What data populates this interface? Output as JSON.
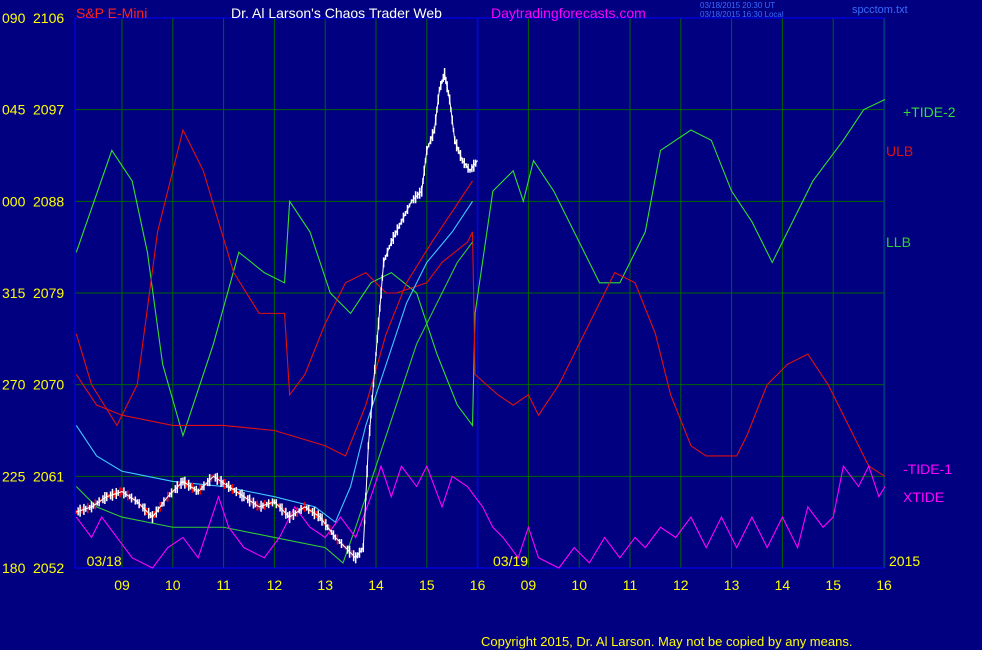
{
  "header": {
    "symbol": "S&P E-Mini",
    "title": "Dr. Al Larson's Chaos Trader Web",
    "site": "Daytradingforecasts.com",
    "stamp_line1": "03/18/2015 20:30 UT",
    "stamp_line2": "03/18/2015 16:30 Local",
    "file": "spcctom.txt"
  },
  "footer": {
    "copyright": "Copyright 2015, Dr. Al Larson. May not be copied by any means."
  },
  "colors": {
    "background": "#000080",
    "frame": "#0000ff",
    "grid": "#006400",
    "axis_text": "#ffff00",
    "header_red": "#ff2020",
    "header_white": "#ffffff",
    "header_magenta": "#ff00ff",
    "price": "#ffffff",
    "price_down": "#ff0000",
    "tide2": "#33dd33",
    "ulb": "#e01010",
    "llb": "#33cc33",
    "cyan": "#40c8ff",
    "tide1": "#e01010",
    "xtide": "#ff00ff"
  },
  "chart_data": {
    "type": "line",
    "ylim": [
      2052,
      2106
    ],
    "left_ticks": [
      {
        "label": "090",
        "price": "2106",
        "value": 2106
      },
      {
        "label": "045",
        "price": "2097",
        "value": 2097
      },
      {
        "label": "000",
        "price": "2088",
        "value": 2088
      },
      {
        "label": "315",
        "price": "2079",
        "value": 2079
      },
      {
        "label": "270",
        "price": "2070",
        "value": 2070
      },
      {
        "label": "225",
        "price": "2061",
        "value": 2061
      },
      {
        "label": "180",
        "price": "2052",
        "value": 2052
      }
    ],
    "hour_labels": [
      "09",
      "10",
      "11",
      "12",
      "13",
      "14",
      "15",
      "16",
      "09",
      "10",
      "11",
      "12",
      "13",
      "14",
      "15",
      "16"
    ],
    "hour_index": [
      0,
      1,
      2,
      3,
      4,
      5,
      6,
      7,
      8,
      9,
      10,
      11,
      12,
      13,
      14,
      15
    ],
    "x_start": -0.9,
    "x_end": 15.05,
    "date_labels": [
      {
        "text": "03/18",
        "at": -0.5
      },
      {
        "text": "03/19",
        "at": 7.5
      }
    ],
    "year_label": "2015",
    "divider_at": 7.0,
    "series": [
      {
        "name": "+TIDE-2",
        "color": "#33dd33",
        "points": [
          [
            -0.9,
            2083
          ],
          [
            -0.2,
            2093
          ],
          [
            0.2,
            2090
          ],
          [
            0.5,
            2083
          ],
          [
            0.8,
            2072
          ],
          [
            1.2,
            2065
          ],
          [
            1.8,
            2074
          ],
          [
            2.3,
            2083
          ],
          [
            2.8,
            2081
          ],
          [
            3.2,
            2080
          ],
          [
            3.3,
            2088
          ],
          [
            3.7,
            2085
          ],
          [
            4.1,
            2079
          ],
          [
            4.5,
            2077
          ],
          [
            4.9,
            2080
          ],
          [
            5.3,
            2081
          ],
          [
            5.8,
            2079
          ],
          [
            6.2,
            2073
          ],
          [
            6.6,
            2068
          ],
          [
            6.9,
            2066
          ],
          [
            6.95,
            2077
          ],
          [
            7.3,
            2089
          ],
          [
            7.7,
            2091
          ],
          [
            7.9,
            2088
          ],
          [
            8.1,
            2092
          ],
          [
            8.5,
            2089
          ],
          [
            8.9,
            2085
          ],
          [
            9.4,
            2080
          ],
          [
            9.8,
            2080
          ],
          [
            10.3,
            2085
          ],
          [
            10.6,
            2093
          ],
          [
            11.2,
            2095
          ],
          [
            11.6,
            2094
          ],
          [
            12.0,
            2089
          ],
          [
            12.4,
            2086
          ],
          [
            12.8,
            2082
          ],
          [
            13.2,
            2086
          ],
          [
            13.6,
            2090
          ],
          [
            14.2,
            2094
          ],
          [
            14.6,
            2097
          ],
          [
            15.05,
            2098
          ]
        ]
      },
      {
        "name": "ULB",
        "color": "#e01010",
        "points": [
          [
            -0.9,
            2075
          ],
          [
            -0.6,
            2070
          ],
          [
            -0.1,
            2066
          ],
          [
            0.3,
            2070
          ],
          [
            0.7,
            2085
          ],
          [
            1.2,
            2095
          ],
          [
            1.6,
            2091
          ],
          [
            2.2,
            2081
          ],
          [
            2.7,
            2077
          ],
          [
            3.2,
            2077
          ],
          [
            3.3,
            2069
          ],
          [
            3.6,
            2071
          ],
          [
            4.0,
            2076
          ],
          [
            4.4,
            2080
          ],
          [
            4.8,
            2081
          ],
          [
            5.2,
            2079
          ],
          [
            5.4,
            2079
          ],
          [
            6.0,
            2080
          ],
          [
            6.3,
            2082
          ],
          [
            6.8,
            2084
          ],
          [
            6.9,
            2085
          ],
          [
            6.95,
            2071
          ],
          [
            7.4,
            2069
          ],
          [
            7.7,
            2068
          ],
          [
            8.0,
            2069
          ],
          [
            8.2,
            2067
          ],
          [
            8.6,
            2070
          ],
          [
            9.2,
            2076
          ],
          [
            9.7,
            2081
          ],
          [
            10.1,
            2080
          ],
          [
            10.5,
            2075
          ],
          [
            10.8,
            2069
          ],
          [
            11.2,
            2064
          ],
          [
            11.5,
            2063
          ],
          [
            12.1,
            2063
          ],
          [
            12.3,
            2065
          ],
          [
            12.7,
            2070
          ],
          [
            13.1,
            2072
          ],
          [
            13.5,
            2073
          ],
          [
            13.9,
            2070
          ],
          [
            14.3,
            2066
          ],
          [
            14.7,
            2062
          ],
          [
            15.05,
            2061
          ]
        ]
      },
      {
        "name": "LLB",
        "color": "#33cc33",
        "points": [
          [
            -0.9,
            2060
          ],
          [
            -0.5,
            2058
          ],
          [
            0,
            2057
          ],
          [
            1,
            2056
          ],
          [
            2,
            2056
          ],
          [
            3,
            2055
          ],
          [
            4,
            2054
          ],
          [
            4.35,
            2052.5
          ],
          [
            4.6,
            2056
          ],
          [
            5.0,
            2062
          ],
          [
            5.4,
            2068
          ],
          [
            5.8,
            2074
          ],
          [
            6.2,
            2078
          ],
          [
            6.6,
            2082
          ],
          [
            6.9,
            2084
          ]
        ]
      },
      {
        "name": "cyan",
        "color": "#40c8ff",
        "points": [
          [
            -0.9,
            2066
          ],
          [
            -0.5,
            2063
          ],
          [
            0,
            2061.5
          ],
          [
            0.5,
            2061
          ],
          [
            1,
            2060.5
          ],
          [
            2,
            2060
          ],
          [
            3,
            2059
          ],
          [
            3.8,
            2058
          ],
          [
            4.2,
            2056.5
          ],
          [
            4.5,
            2060
          ],
          [
            4.8,
            2066
          ],
          [
            5.2,
            2072
          ],
          [
            5.6,
            2078
          ],
          [
            6.0,
            2082
          ],
          [
            6.5,
            2085
          ],
          [
            6.9,
            2088
          ]
        ]
      },
      {
        "name": "lower-red",
        "color": "#e01010",
        "points": [
          [
            -0.9,
            2071
          ],
          [
            -0.5,
            2068
          ],
          [
            0,
            2067
          ],
          [
            1,
            2066
          ],
          [
            2,
            2066
          ],
          [
            3,
            2065.5
          ],
          [
            4,
            2064
          ],
          [
            4.4,
            2063
          ],
          [
            4.8,
            2068
          ],
          [
            5.2,
            2075
          ],
          [
            5.6,
            2080
          ],
          [
            6.1,
            2084
          ],
          [
            6.5,
            2087
          ],
          [
            6.9,
            2090
          ]
        ]
      },
      {
        "name": "-TIDE-1",
        "color": "#ff00ff",
        "points": [
          [
            -0.9,
            2057
          ],
          [
            -0.6,
            2055
          ],
          [
            -0.4,
            2057
          ],
          [
            -0.1,
            2055
          ],
          [
            0.2,
            2053
          ],
          [
            0.6,
            2052
          ],
          [
            0.9,
            2054
          ],
          [
            1.2,
            2055
          ],
          [
            1.5,
            2053
          ],
          [
            1.9,
            2059
          ],
          [
            2.1,
            2056
          ],
          [
            2.4,
            2054
          ],
          [
            2.8,
            2053
          ],
          [
            3.1,
            2055
          ],
          [
            3.4,
            2058
          ],
          [
            3.7,
            2056
          ],
          [
            4.0,
            2055
          ],
          [
            4.3,
            2057
          ],
          [
            4.6,
            2055
          ],
          [
            4.9,
            2059
          ],
          [
            5.1,
            2062
          ],
          [
            5.3,
            2059
          ],
          [
            5.5,
            2062
          ],
          [
            5.8,
            2060
          ],
          [
            6.0,
            2062
          ],
          [
            6.3,
            2058
          ],
          [
            6.5,
            2061
          ],
          [
            6.8,
            2060
          ],
          [
            7.1,
            2058
          ],
          [
            7.3,
            2056
          ],
          [
            7.5,
            2055
          ],
          [
            7.8,
            2053
          ],
          [
            8.0,
            2056
          ],
          [
            8.2,
            2053
          ],
          [
            8.6,
            2052
          ],
          [
            8.9,
            2054
          ],
          [
            9.2,
            2052.5
          ],
          [
            9.5,
            2055
          ],
          [
            9.8,
            2053
          ],
          [
            10.1,
            2055
          ],
          [
            10.3,
            2054
          ],
          [
            10.6,
            2056
          ],
          [
            10.9,
            2055
          ],
          [
            11.2,
            2057
          ],
          [
            11.5,
            2054
          ],
          [
            11.8,
            2057
          ],
          [
            12.1,
            2054
          ],
          [
            12.4,
            2057
          ],
          [
            12.7,
            2054
          ],
          [
            13.0,
            2057
          ],
          [
            13.3,
            2054
          ],
          [
            13.5,
            2058
          ],
          [
            13.8,
            2056
          ],
          [
            14.0,
            2057
          ],
          [
            14.2,
            2062
          ],
          [
            14.5,
            2060
          ],
          [
            14.7,
            2062
          ],
          [
            14.9,
            2059
          ],
          [
            15.05,
            2060
          ]
        ]
      },
      {
        "name": "XTIDE",
        "color": "#ff00ff",
        "points": []
      }
    ],
    "price": {
      "color": "#ffffff",
      "points": [
        [
          -0.9,
          2057.5
        ],
        [
          -0.6,
          2058
        ],
        [
          -0.3,
          2059
        ],
        [
          0,
          2059.5
        ],
        [
          0.3,
          2058.5
        ],
        [
          0.6,
          2057
        ],
        [
          0.9,
          2059
        ],
        [
          1.2,
          2060.5
        ],
        [
          1.5,
          2059.5
        ],
        [
          1.8,
          2061
        ],
        [
          2.1,
          2060
        ],
        [
          2.4,
          2059
        ],
        [
          2.7,
          2058
        ],
        [
          3.0,
          2058.5
        ],
        [
          3.3,
          2057
        ],
        [
          3.6,
          2058
        ],
        [
          3.9,
          2057
        ],
        [
          4.2,
          2055
        ],
        [
          4.4,
          2054
        ],
        [
          4.6,
          2053
        ],
        [
          4.75,
          2054
        ],
        [
          4.85,
          2064
        ],
        [
          4.95,
          2070
        ],
        [
          5.05,
          2076
        ],
        [
          5.15,
          2082
        ],
        [
          5.3,
          2084
        ],
        [
          5.5,
          2086
        ],
        [
          5.7,
          2088
        ],
        [
          5.9,
          2089
        ],
        [
          6.0,
          2093
        ],
        [
          6.15,
          2095
        ],
        [
          6.25,
          2099
        ],
        [
          6.35,
          2100.5
        ],
        [
          6.45,
          2098
        ],
        [
          6.55,
          2094
        ],
        [
          6.7,
          2092
        ],
        [
          6.85,
          2091
        ],
        [
          7.0,
          2092
        ]
      ]
    }
  }
}
